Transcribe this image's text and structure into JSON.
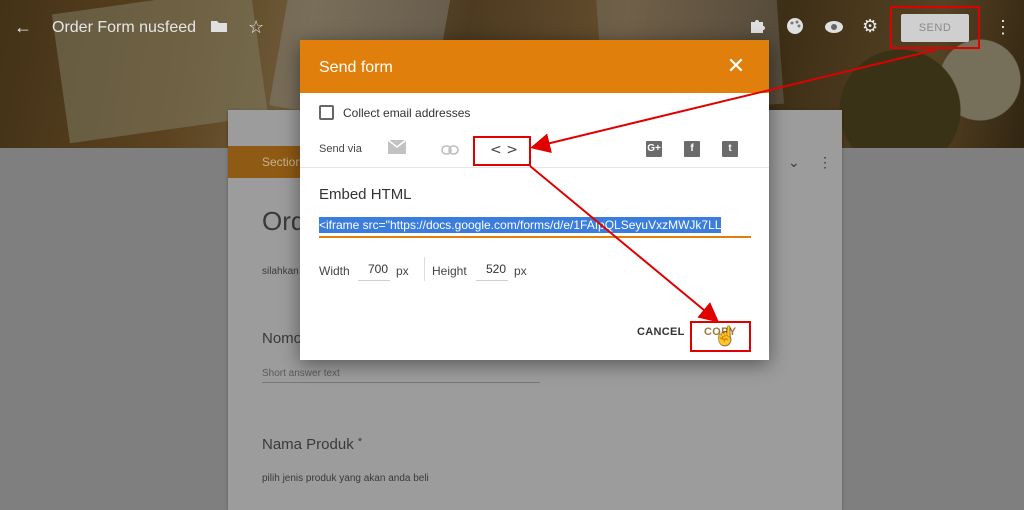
{
  "topbar": {
    "title": "Order Form nusfeed",
    "send_label": "SEND",
    "icons": [
      "back-arrow-icon",
      "folder-icon",
      "star-icon",
      "puzzle-icon",
      "palette-icon",
      "eye-icon",
      "gear-icon",
      "more-vert-icon"
    ]
  },
  "form": {
    "section_label": "Section",
    "title_partial": "Ord",
    "description_partial": "silahkan",
    "question1_partial": "Nomo",
    "question1_placeholder": "Short answer text",
    "question2_title": "Nama Produk",
    "question2_required": "*",
    "question2_description": "pilih jenis produk yang akan anda beli"
  },
  "dialog": {
    "title": "Send form",
    "collect_email_label": "Collect email addresses",
    "send_via_label": "Send via",
    "embed_icon_glyph": "< >",
    "social": [
      "G+",
      "f",
      "t"
    ],
    "embed_title": "Embed HTML",
    "embed_code": "<iframe src=\"https://docs.google.com/forms/d/e/1FAIpQLSeyuVxzMWJk7LL",
    "width_label": "Width",
    "width_value": "700",
    "width_unit": "px",
    "height_label": "Height",
    "height_value": "520",
    "height_unit": "px",
    "cancel_label": "CANCEL",
    "copy_label": "COPY"
  },
  "colors": {
    "accent": "#e07f0b",
    "selection": "#3b7ddd",
    "highlight": "#e00000"
  }
}
